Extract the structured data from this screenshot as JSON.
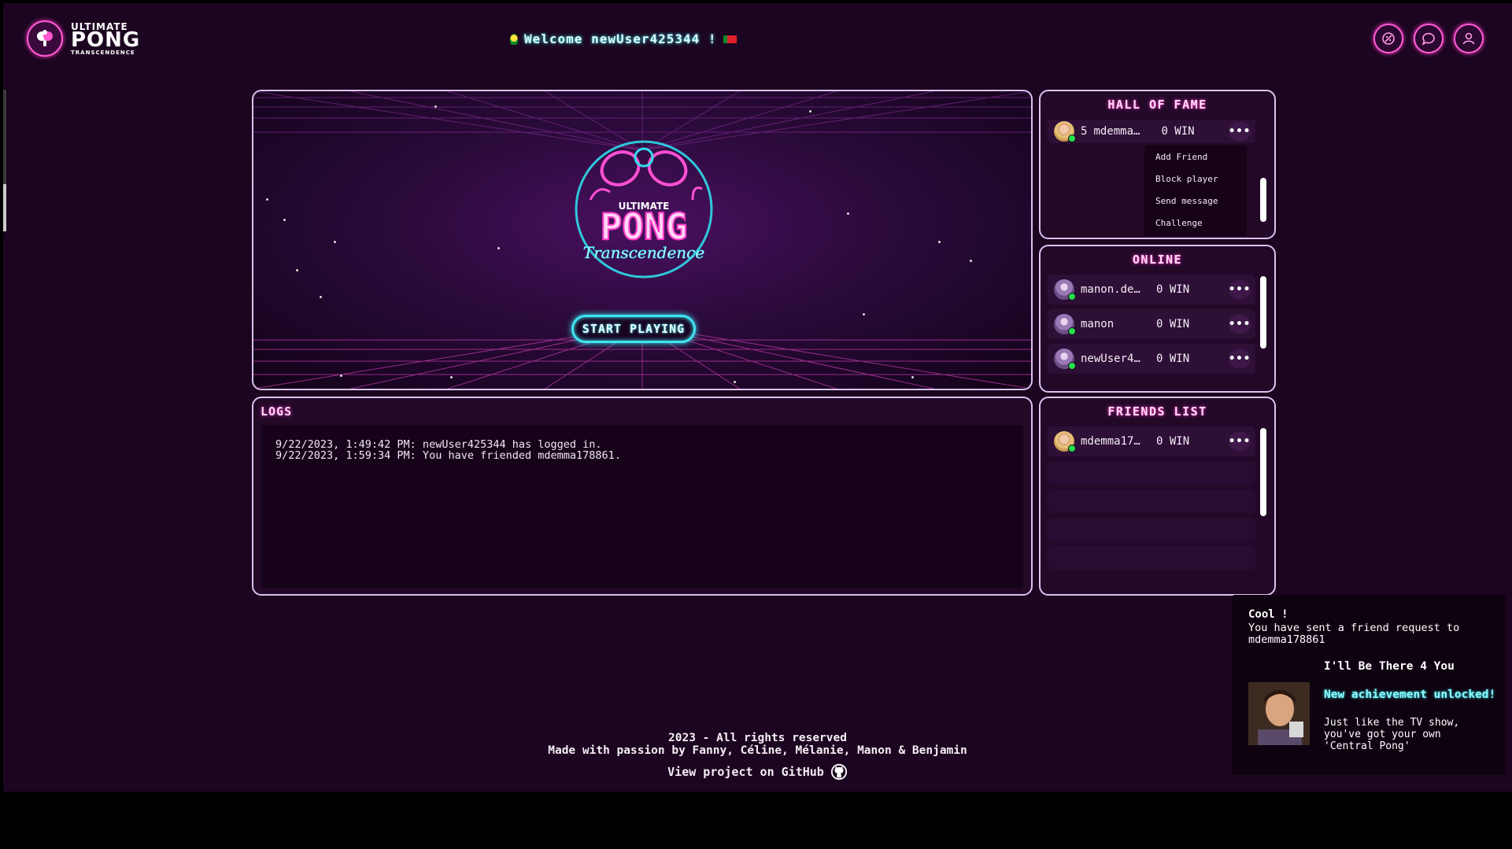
{
  "header": {
    "logo": {
      "line1": "ULTIMATE",
      "line2": "PONG",
      "line3": "TRANSCENDENCE"
    },
    "welcome": "Welcome newUser425344 !",
    "icons": [
      "game-controller-icon",
      "chat-icon",
      "profile-icon"
    ]
  },
  "game": {
    "logo": {
      "top": "ULTIMATE",
      "main": "PONG",
      "script": "Transcendence"
    },
    "start_label": "START PLAYING"
  },
  "logs": {
    "title": "LOGS",
    "entries": [
      "9/22/2023, 1:49:42 PM: newUser425344 has logged in.",
      "9/22/2023, 1:59:34 PM: You have friended mdemma178861."
    ]
  },
  "hall_of_fame": {
    "title": "HALL OF FAME",
    "rows": [
      {
        "rank": "5",
        "name": "mdemma…",
        "wins": "0 WIN"
      }
    ],
    "menu": [
      "Add Friend",
      "Block player",
      "Send message",
      "Challenge"
    ]
  },
  "online": {
    "title": "ONLINE",
    "rows": [
      {
        "name": "manon.de…",
        "wins": "0 WIN"
      },
      {
        "name": "manon",
        "wins": "0 WIN"
      },
      {
        "name": "newUser4…",
        "wins": "0 WIN"
      }
    ]
  },
  "friends": {
    "title": "FRIENDS LIST",
    "rows": [
      {
        "name": "mdemma17…",
        "wins": "0 WIN"
      }
    ]
  },
  "footer": {
    "copyright": "2023 - All rights reserved",
    "credits": "Made with passion by Fanny, Céline, Mélanie, Manon & Benjamin",
    "github": "View project on GitHub"
  },
  "toast": {
    "title": "Cool !",
    "message": "You have sent a friend request to mdemma178861",
    "achievement_title": "I'll Be There 4 You",
    "achievement_status": "New achievement unlocked!",
    "achievement_desc": "Just like the TV show, you've got your own 'Central Pong'"
  },
  "colors": {
    "accent_pink": "#ff3cc8",
    "accent_cyan": "#3fe4f0",
    "background": "#1c0520",
    "online_dot": "#22e04a"
  }
}
